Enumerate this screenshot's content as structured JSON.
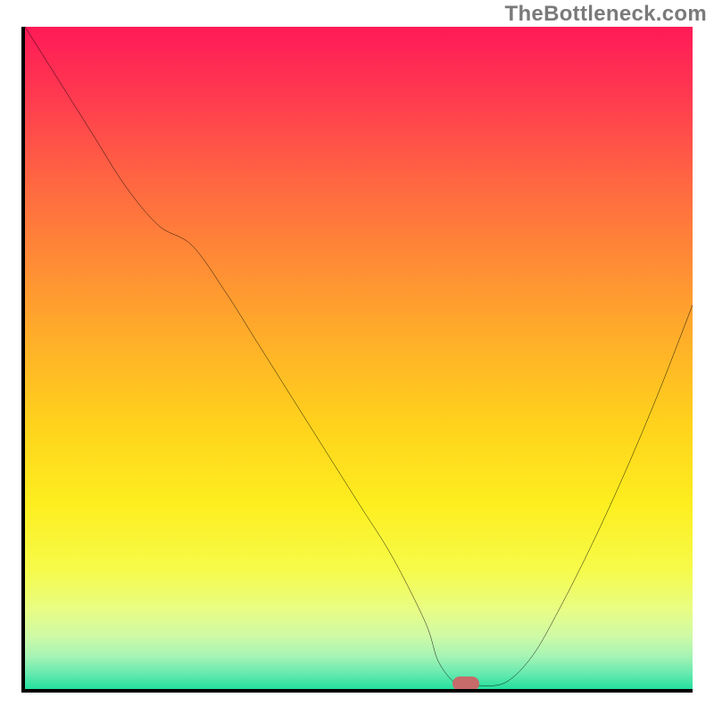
{
  "watermark": "TheBottleneck.com",
  "chart_data": {
    "type": "line",
    "title": "",
    "xlabel": "",
    "ylabel": "",
    "xlim": [
      0,
      100
    ],
    "ylim": [
      0,
      100
    ],
    "x": [
      0,
      5,
      10,
      15,
      20,
      25,
      30,
      35,
      40,
      45,
      50,
      55,
      60,
      62,
      65,
      68,
      72,
      76,
      80,
      85,
      90,
      95,
      100
    ],
    "values": [
      100,
      92,
      84,
      76,
      70,
      67,
      60,
      52,
      44,
      36,
      28,
      20,
      10,
      4,
      0.5,
      0.5,
      1,
      5,
      12,
      22,
      33,
      45,
      58
    ],
    "marker": {
      "x": 66,
      "y": 0.8,
      "color": "#c66a6a"
    },
    "gradient_stops": [
      {
        "pos": 0.0,
        "color": "#ff1a57"
      },
      {
        "pos": 0.1,
        "color": "#ff3850"
      },
      {
        "pos": 0.22,
        "color": "#ff6243"
      },
      {
        "pos": 0.35,
        "color": "#ff8a36"
      },
      {
        "pos": 0.48,
        "color": "#ffb128"
      },
      {
        "pos": 0.6,
        "color": "#ffd21c"
      },
      {
        "pos": 0.72,
        "color": "#fdee1f"
      },
      {
        "pos": 0.82,
        "color": "#f6fb4a"
      },
      {
        "pos": 0.88,
        "color": "#e8fd84"
      },
      {
        "pos": 0.92,
        "color": "#cffaa6"
      },
      {
        "pos": 0.95,
        "color": "#a6f4b4"
      },
      {
        "pos": 0.975,
        "color": "#6beab0"
      },
      {
        "pos": 1.0,
        "color": "#24e09e"
      }
    ]
  }
}
